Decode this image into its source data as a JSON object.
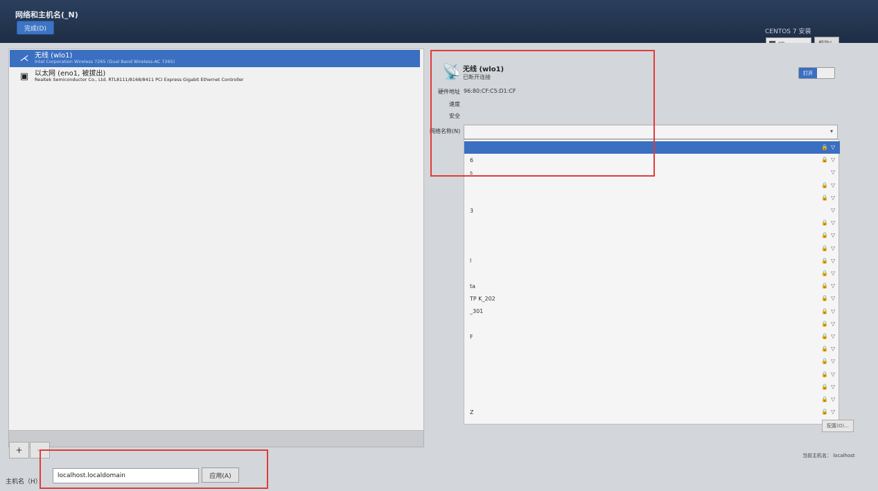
{
  "header": {
    "title": "网络和主机名(_N)",
    "done_label": "完成(D)",
    "os_title": "CENTOS 7 安装",
    "lang": "cn",
    "help_label": "帮助！"
  },
  "devices": [
    {
      "name": "无线 (wlo1)",
      "desc": "Intel Corporation Wireless 7265 (Dual Band Wireless-AC 7265)"
    },
    {
      "name": "以太网 (eno1, 被拔出)",
      "desc": "Realtek Semiconductor Co., Ltd. RTL8111/8168/8411 PCI Express Gigabit Ethernet Controller"
    }
  ],
  "toolbar": {
    "add": "+",
    "remove": "−"
  },
  "hostname": {
    "label": "主机名（H）：",
    "value": "localhost.localdomain",
    "apply_label": "应用(A)",
    "current_label": "当前主机名：",
    "current_value": "localhost"
  },
  "detail": {
    "name": "无线 (wlo1)",
    "status": "已断开连接",
    "toggle_label": "打开",
    "hw_label": "硬件地址",
    "hw_value": "96:80:CF:C5:D1:CF",
    "speed_label": "速度",
    "security_label": "安全",
    "network_label": "网络名称(N)",
    "config_label": "配置(O)..."
  },
  "networks": [
    {
      "ssid": "",
      "lock": true
    },
    {
      "ssid": "6",
      "lock": true
    },
    {
      "ssid": "s",
      "lock": false
    },
    {
      "ssid": "",
      "lock": true
    },
    {
      "ssid": "",
      "lock": true
    },
    {
      "ssid": "3",
      "lock": false
    },
    {
      "ssid": "",
      "lock": true
    },
    {
      "ssid": "",
      "lock": true
    },
    {
      "ssid": "",
      "lock": true
    },
    {
      "ssid": "l",
      "lock": true
    },
    {
      "ssid": "",
      "lock": true
    },
    {
      "ssid": "ta",
      "lock": true
    },
    {
      "ssid": "TP K_202",
      "lock": true
    },
    {
      "ssid": "_301",
      "lock": true
    },
    {
      "ssid": "",
      "lock": true
    },
    {
      "ssid": "F",
      "lock": true
    },
    {
      "ssid": "",
      "lock": true
    },
    {
      "ssid": "",
      "lock": true
    },
    {
      "ssid": "",
      "lock": true
    },
    {
      "ssid": "",
      "lock": true
    },
    {
      "ssid": "",
      "lock": true
    },
    {
      "ssid": "Z",
      "lock": true
    }
  ]
}
